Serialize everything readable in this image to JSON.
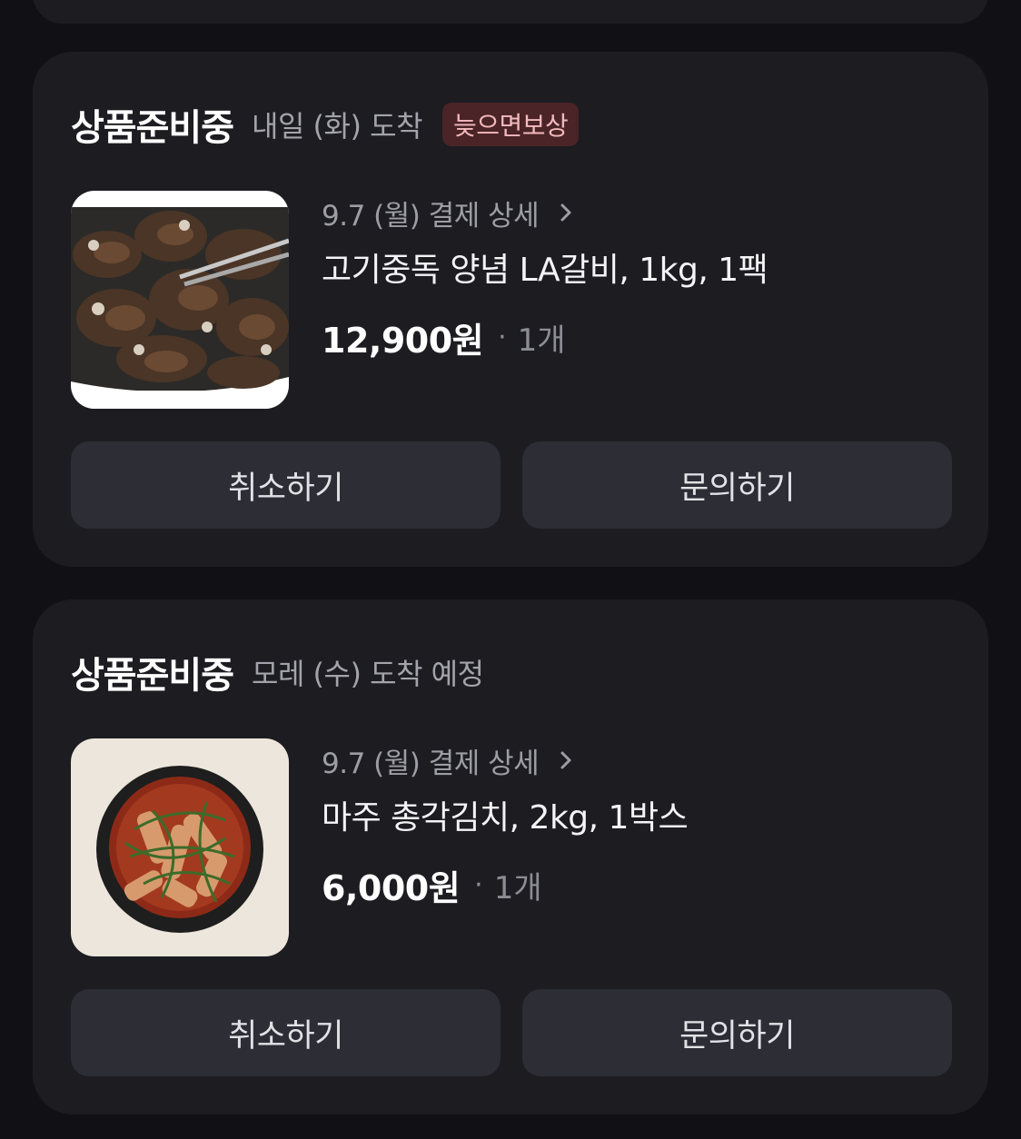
{
  "orders": [
    {
      "status": "상품준비중",
      "eta": "내일 (화) 도착",
      "badge": "늦으면보상",
      "detail_link": "9.7 (월) 결제 상세",
      "product_name": "고기중독 양념 LA갈비, 1kg, 1팩",
      "price": "12,900원",
      "separator": "·",
      "quantity": "1개",
      "image_icon": "la-galbi-photo",
      "buttons": {
        "cancel": "취소하기",
        "inquiry": "문의하기"
      }
    },
    {
      "status": "상품준비중",
      "eta": "모레 (수) 도착 예정",
      "detail_link": "9.7 (월) 결제 상세",
      "product_name": "마주 총각김치, 2kg, 1박스",
      "price": "6,000원",
      "separator": "·",
      "quantity": "1개",
      "image_icon": "chonggak-kimchi-photo",
      "buttons": {
        "cancel": "취소하기",
        "inquiry": "문의하기"
      }
    }
  ],
  "colors": {
    "background": "#111115",
    "card": "#1c1c21",
    "button": "#2d2d35",
    "badge_bg": "#4a2427",
    "badge_text": "#f3b9bd",
    "muted_text": "#a3a3aa"
  }
}
